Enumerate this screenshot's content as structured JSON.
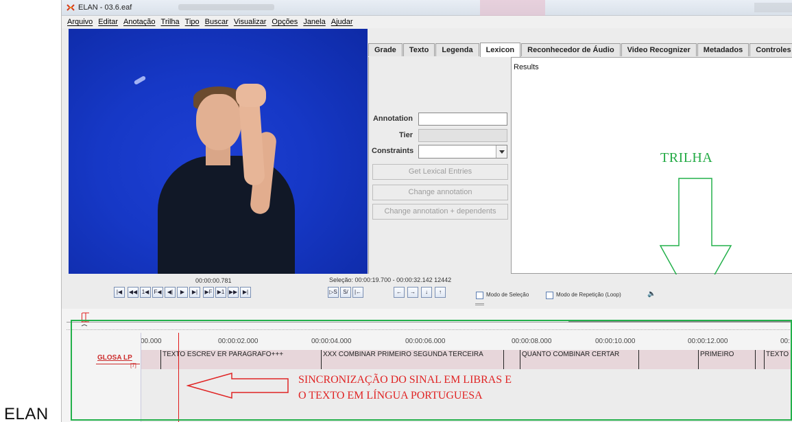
{
  "caption": "ELAN",
  "window": {
    "title": "ELAN - 03.6.eaf"
  },
  "menu": [
    "Arquivo",
    "Editar",
    "Anotação",
    "Trilha",
    "Tipo",
    "Buscar",
    "Visualizar",
    "Opções",
    "Janela",
    "Ajudar"
  ],
  "tabs": [
    {
      "label": "Grade"
    },
    {
      "label": "Texto"
    },
    {
      "label": "Legenda"
    },
    {
      "label": "Lexicon"
    },
    {
      "label": "Reconhecedor de Áudio"
    },
    {
      "label": "Video Recognizer"
    },
    {
      "label": "Metadados"
    },
    {
      "label": "Controles"
    }
  ],
  "lexicon": {
    "annotation_label": "Annotation",
    "tier_label": "Tier",
    "constraints_label": "Constraints",
    "get_entries": "Get Lexical Entries",
    "change_annotation": "Change annotation",
    "change_dependents": "Change annotation + dependents",
    "results_label": "Results"
  },
  "annotations_overlay": {
    "trilha": "TRILHA",
    "sync_line1": "SINCRONIZAÇÃO DO SINAL EM LIBRAS E",
    "sync_line2": "O TEXTO EM LÍNGUA PORTUGUESA",
    "highlight_color": "#22b04a",
    "arrow_color": "#e02424"
  },
  "player": {
    "time": "00:00:00.781",
    "selection": "Seleção: 00:00:19.700 - 00:00:32.142  12442",
    "buttons": [
      "|◀",
      "◀◀",
      "1◀",
      "F◀",
      "◀|",
      "▶",
      "▶|",
      "▶F",
      "▶1",
      "▶▶",
      "▶|"
    ],
    "buttons2": [
      "▷S",
      "S/",
      "|←"
    ],
    "nav": [
      "←",
      "→",
      "↓",
      "↑"
    ],
    "selection_mode": "Modo de Seleção",
    "loop_mode": "Modo de Repetição (Loop)"
  },
  "ruler": {
    "labels": [
      "00.000",
      "00:00:02.000",
      "00:00:04.000",
      "00:00:06.000",
      "00:00:08.000",
      "00:00:10.000",
      "00:00:12.000",
      "00:"
    ]
  },
  "tier": {
    "name": "GLOSA LP",
    "sub": "[7]",
    "annotations": [
      "TEXTO ESCREV ER PARAGRAFO+++",
      "XXX COMBINAR PRIMEIRO SEGUNDA TERCEIRA",
      "QUANTO COMBINAR CERTAR",
      "PRIMEIRO",
      "TEXTO"
    ]
  }
}
